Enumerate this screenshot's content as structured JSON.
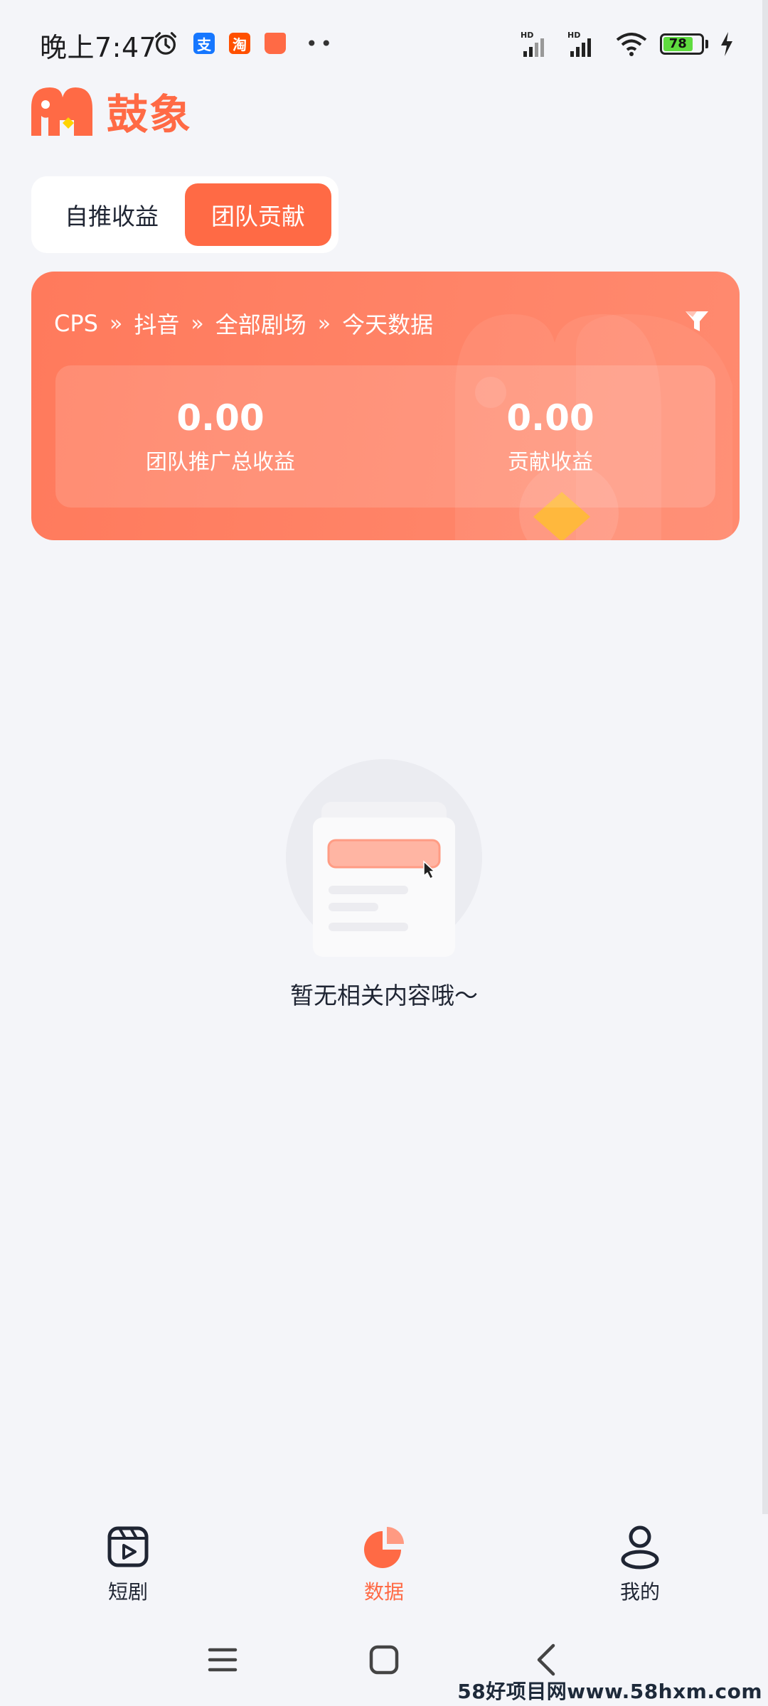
{
  "status_bar": {
    "time": "晚上7:47",
    "battery": "78",
    "net_label_1": "HD",
    "net_label_2": "HD"
  },
  "app": {
    "logo_text": "鼓象",
    "brand_color": "#ff6a45"
  },
  "tabs": [
    {
      "label": "自推收益",
      "active": false
    },
    {
      "label": "团队贡献",
      "active": true
    }
  ],
  "card": {
    "breadcrumb": [
      "CPS",
      "抖音",
      "全部剧场",
      "今天数据"
    ],
    "separator": "»",
    "stats": [
      {
        "value": "0.00",
        "label": "团队推广总收益"
      },
      {
        "value": "0.00",
        "label": "贡献收益"
      }
    ],
    "filter_icon": "filter-icon"
  },
  "empty_state": {
    "text": "暂无相关内容哦～"
  },
  "bottom_nav": [
    {
      "label": "短剧",
      "icon": "play-card-icon",
      "active": false
    },
    {
      "label": "数据",
      "icon": "pie-chart-icon",
      "active": true
    },
    {
      "label": "我的",
      "icon": "person-icon",
      "active": false
    }
  ],
  "watermark": "58好项目网www.58hxm.com"
}
